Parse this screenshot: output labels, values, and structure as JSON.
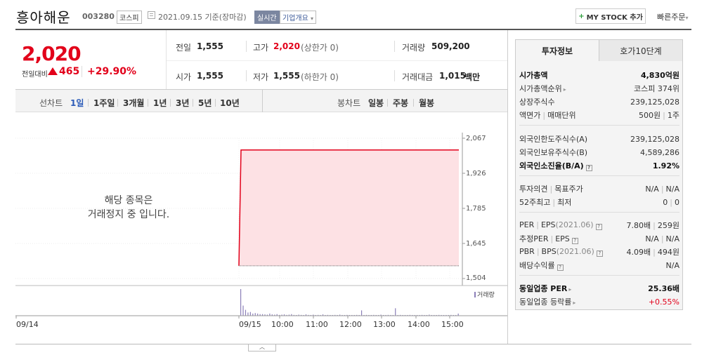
{
  "header": {
    "name": "흥아해운",
    "code": "003280",
    "market": "코스피",
    "date_basis": "2021.09.15 기준(장마감)",
    "realtime": "실시간",
    "company_overview": "기업개요",
    "mystock_label": "MY STOCK 추가",
    "quick_order": "빠른주문"
  },
  "price": {
    "current": "2,020",
    "change_label": "전일대비",
    "change": "465",
    "change_pct": "+29.90%"
  },
  "quote": {
    "prev_close_label": "전일",
    "prev_close": "1,555",
    "high_label": "고가",
    "high": "2,020",
    "high_note": "(상한가 0)",
    "volume_label": "거래량",
    "volume": "509,200",
    "open_label": "시가",
    "open": "1,555",
    "low_label": "저가",
    "low": "1,555",
    "low_note": "(하한가 0)",
    "value_label": "거래대금",
    "value": "1,015",
    "value_unit": "백만"
  },
  "chart_tabs": {
    "line_label": "선차트",
    "periods": [
      "1일",
      "1주일",
      "3개월",
      "1년",
      "3년",
      "5년",
      "10년"
    ],
    "active_period": 0,
    "candle_label": "봉차트",
    "candles": [
      "일봉",
      "주봉",
      "월봉"
    ]
  },
  "halt_message": {
    "line1": "해당 종목은",
    "line2": "거래정지 중 입니다."
  },
  "chart_data": {
    "type": "area",
    "x": [
      "09/14",
      "09/15 09:00",
      "09/15 09:00",
      "09/15 15:30"
    ],
    "values": [
      1555,
      1555,
      2020,
      2020
    ],
    "y_ticks": [
      "2,067",
      "1,926",
      "1,785",
      "1,645",
      "1,504"
    ],
    "ylim": [
      1504,
      2067
    ],
    "x_ticks": [
      "09/14",
      "09/15",
      "10:00",
      "11:00",
      "12:00",
      "13:00",
      "14:00",
      "15:00"
    ],
    "volume_label": "거래량",
    "volume_bars": [
      100,
      38,
      22,
      12,
      14,
      8,
      10,
      8,
      6,
      6,
      5,
      4,
      8,
      5,
      4,
      6,
      3,
      4,
      5,
      3,
      4,
      6,
      3,
      2,
      4,
      3,
      2,
      5,
      3,
      2,
      4,
      2,
      3,
      2,
      5,
      2,
      3,
      2,
      2,
      3,
      2,
      4,
      2,
      2,
      3,
      2,
      2,
      2,
      3,
      2,
      20,
      2,
      3,
      2,
      2,
      3,
      2,
      2,
      4,
      2,
      2,
      3,
      2,
      2,
      28,
      2,
      3,
      2,
      2,
      2,
      3,
      2,
      2,
      2,
      2,
      3,
      2,
      2,
      4,
      2,
      2,
      2,
      3,
      2,
      2,
      2,
      2,
      3,
      2,
      2,
      8
    ]
  },
  "colors": {
    "up": "#e2001a",
    "area_fill": "#fde1e4",
    "volume": "#8b7fb8"
  },
  "invest": {
    "tab1": "투자정보",
    "tab2": "호가10단계",
    "market_cap_label": "시가총액",
    "market_cap": "4,830억원",
    "cap_rank_label": "시가총액순위",
    "cap_rank": "코스피 374위",
    "shares_label": "상장주식수",
    "shares": "239,125,028",
    "par_label": "액면가",
    "unit_label": "매매단위",
    "par": "500원",
    "unit": "1주",
    "foreign_limit_label": "외국인한도주식수(A)",
    "foreign_limit": "239,125,028",
    "foreign_hold_label": "외국인보유주식수(B)",
    "foreign_hold": "4,589,286",
    "foreign_ratio_label": "외국인소진율(B/A)",
    "foreign_ratio": "1.92%",
    "opinion_label": "투자의견",
    "target_label": "목표주가",
    "opinion": "N/A",
    "target": "N/A",
    "high52_label": "52주최고",
    "low52_label": "최저",
    "high52": "0",
    "low52": "0",
    "per_label": "PER",
    "eps_label": "EPS",
    "eps_year": "(2021.06)",
    "per": "7.80배",
    "eps": "259원",
    "est_per_label": "추정PER",
    "est_eps_label": "EPS",
    "est_per": "N/A",
    "est_eps": "N/A",
    "pbr_label": "PBR",
    "bps_label": "BPS",
    "bps_year": "(2021.06)",
    "pbr": "4.09배",
    "bps": "494원",
    "div_label": "배당수익률",
    "div": "N/A",
    "sector_per_label": "동일업종 PER",
    "sector_per": "25.36배",
    "sector_chg_label": "동일업종 등락률",
    "sector_chg": "+0.55%"
  }
}
